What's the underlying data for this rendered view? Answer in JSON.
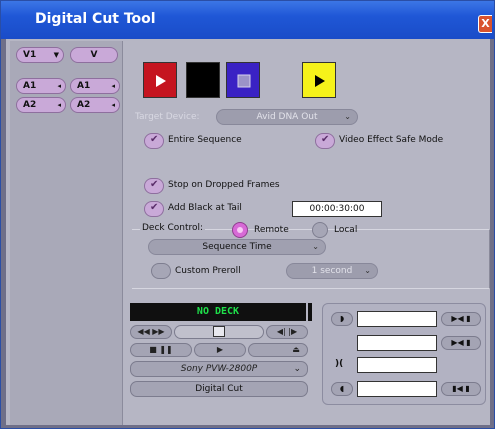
{
  "window": {
    "title": "Digital Cut Tool",
    "close_label": "X"
  },
  "tracks": {
    "video": [
      {
        "label": "V1"
      },
      {
        "label": "V"
      }
    ],
    "audio_rows": [
      [
        {
          "label": "A1"
        },
        {
          "label": "A1"
        }
      ],
      [
        {
          "label": "A2"
        },
        {
          "label": "A2"
        }
      ]
    ]
  },
  "preview_buttons": [
    {
      "name": "play-digital-cut",
      "color": "#c5141f",
      "icon": "play-icon"
    },
    {
      "name": "black-preview",
      "color": "#000000",
      "icon": ""
    },
    {
      "name": "stop-digital-cut",
      "color": "#3a22c4",
      "icon": "stop-icon"
    },
    {
      "name": "preview-play",
      "color": "#f6f21a",
      "icon": "play-icon"
    }
  ],
  "target_device": {
    "label": "Target Device:",
    "value": "Avid DNA Out"
  },
  "options": {
    "entire_sequence": {
      "label": "Entire Sequence",
      "checked": true
    },
    "video_safe_mode": {
      "label": "Video Effect Safe Mode",
      "checked": true
    },
    "stop_dropped_frames": {
      "label": "Stop on Dropped Frames",
      "checked": true
    },
    "add_black": {
      "label": "Add Black at Tail",
      "checked": true,
      "value": "00:00:30:00"
    }
  },
  "deck_control": {
    "label": "Deck Control:",
    "remote": {
      "label": "Remote",
      "selected": true
    },
    "local": {
      "label": "Local",
      "selected": false
    },
    "sequence_time": "Sequence Time",
    "custom_preroll": {
      "label": "Custom Preroll",
      "value": "1 second"
    }
  },
  "deck_controller": {
    "status": "NO DECK",
    "deck_name": "Sony PVW-2800P",
    "digital_cut_label": "Digital Cut"
  },
  "colors": {
    "accent": "#c9a9d8",
    "title_bar": "#1f57d6",
    "panel": "#b6b6c4"
  }
}
